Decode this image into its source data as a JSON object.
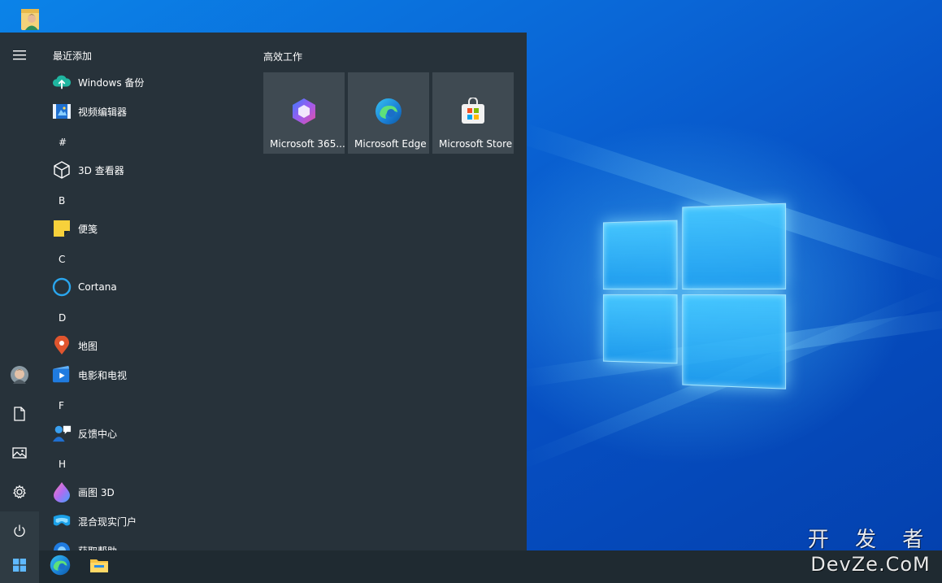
{
  "start_menu": {
    "recent_header": "最近添加",
    "tiles_header": "高效工作",
    "apps": [
      {
        "label": "Windows 备份",
        "icon": "cloud-upload-icon"
      },
      {
        "label": "视频编辑器",
        "icon": "video-editor-icon"
      },
      {
        "letter": "#"
      },
      {
        "label": "3D 查看器",
        "icon": "cube-icon"
      },
      {
        "letter": "B"
      },
      {
        "label": "便笺",
        "icon": "sticky-note-icon"
      },
      {
        "letter": "C"
      },
      {
        "label": "Cortana",
        "icon": "cortana-ring-icon"
      },
      {
        "letter": "D"
      },
      {
        "label": "地图",
        "icon": "map-pin-icon"
      },
      {
        "label": "电影和电视",
        "icon": "movies-tv-icon"
      },
      {
        "letter": "F"
      },
      {
        "label": "反馈中心",
        "icon": "feedback-hub-icon"
      },
      {
        "letter": "H"
      },
      {
        "label": "画图 3D",
        "icon": "paint-3d-icon"
      },
      {
        "label": "混合现实门户",
        "icon": "mixed-reality-icon"
      },
      {
        "label": "获取帮助",
        "icon": "get-help-icon"
      }
    ],
    "tiles": [
      {
        "label": "Microsoft 365...",
        "icon": "microsoft-365-icon"
      },
      {
        "label": "Microsoft Edge",
        "icon": "edge-icon"
      },
      {
        "label": "Microsoft Store",
        "icon": "store-icon"
      }
    ],
    "rail_icons": [
      "hamburger-menu-icon",
      "user-avatar-icon",
      "document-icon",
      "pictures-icon",
      "gear-icon",
      "power-icon"
    ]
  },
  "taskbar": {
    "items": [
      "windows-start-icon",
      "edge-icon",
      "file-explorer-icon"
    ]
  },
  "watermark": {
    "line1": "开 发 者",
    "line2": "DevZe.CoM"
  },
  "colors": {
    "menu_bg": "#27323a",
    "tile_bg": "#3f4a52",
    "taskbar_bg": "#1f2a31",
    "accent": "#0078d7"
  }
}
